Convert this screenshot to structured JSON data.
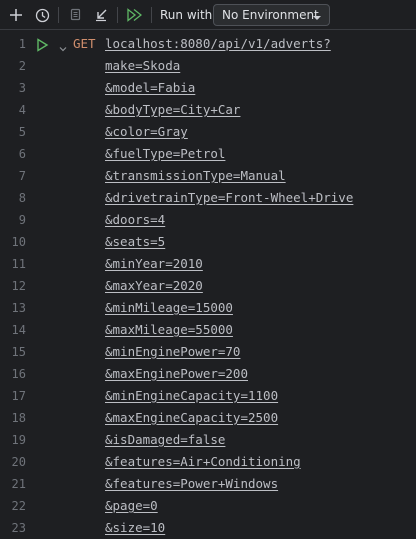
{
  "toolbar": {
    "icons": [
      "add-icon",
      "history-icon",
      "copy-icon",
      "import-icon",
      "run-all-icon"
    ],
    "run_with_label": "Run with:",
    "environment_value": "No Environment"
  },
  "editor": {
    "method": "GET",
    "url": "localhost:8080/api/v1/adverts?",
    "lines": [
      {
        "num": "1"
      },
      {
        "num": "2"
      },
      {
        "num": "3"
      },
      {
        "num": "4"
      },
      {
        "num": "5"
      },
      {
        "num": "6"
      },
      {
        "num": "7"
      },
      {
        "num": "8"
      },
      {
        "num": "9"
      },
      {
        "num": "10"
      },
      {
        "num": "11"
      },
      {
        "num": "12"
      },
      {
        "num": "13"
      },
      {
        "num": "14"
      },
      {
        "num": "15"
      },
      {
        "num": "16"
      },
      {
        "num": "17"
      },
      {
        "num": "18"
      },
      {
        "num": "19"
      },
      {
        "num": "20"
      },
      {
        "num": "21"
      },
      {
        "num": "22"
      },
      {
        "num": "23"
      }
    ],
    "params": [
      "make=Skoda",
      "&model=Fabia",
      "&bodyType=City+Car",
      "&color=Gray",
      "&fuelType=Petrol",
      "&transmissionType=Manual",
      "&drivetrainType=Front-Wheel+Drive",
      "&doors=4",
      "&seats=5",
      "&minYear=2010",
      "&maxYear=2020",
      "&minMileage=15000",
      "&maxMileage=55000",
      "&minEnginePower=70",
      "&maxEnginePower=200",
      "&minEngineCapacity=1100",
      "&maxEngineCapacity=2500",
      "&isDamaged=false",
      "&features=Air+Conditioning",
      "&features=Power+Windows",
      "&page=0",
      "&size=10"
    ]
  },
  "colors": {
    "background": "#1e1f22",
    "keyword": "#cf8e6d",
    "text": "#bcbec4",
    "line_number": "#6f737a",
    "run_green": "#5fb865"
  }
}
